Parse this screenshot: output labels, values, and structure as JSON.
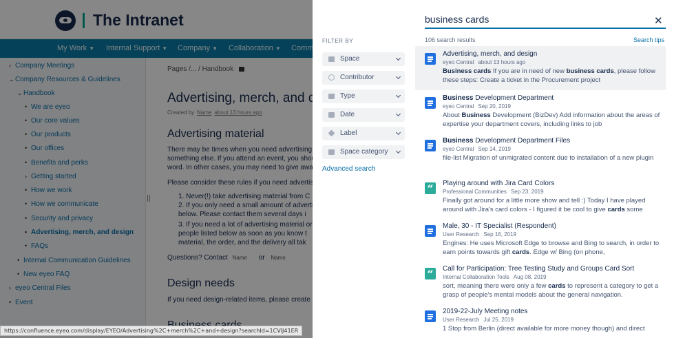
{
  "background": {
    "site_title": "The Intranet",
    "nav": [
      {
        "label": "My Work"
      },
      {
        "label": "Internal Support"
      },
      {
        "label": "Company"
      },
      {
        "label": "Collaboration"
      },
      {
        "label": "Comm"
      }
    ],
    "tree": [
      {
        "marker": "›",
        "label": "Company Meetings"
      },
      {
        "marker": "⌄",
        "label": "Company Resources & Guidelines"
      },
      {
        "marker": "⌄",
        "label": "Handbook"
      },
      {
        "marker": "•",
        "label": "We are eyeo"
      },
      {
        "marker": "•",
        "label": "Our core values"
      },
      {
        "marker": "•",
        "label": "Our products"
      },
      {
        "marker": "•",
        "label": "Our offices"
      },
      {
        "marker": "•",
        "label": "Benefits and perks"
      },
      {
        "marker": "›",
        "label": "Getting started"
      },
      {
        "marker": "•",
        "label": "How we work"
      },
      {
        "marker": "•",
        "label": "How we communicate"
      },
      {
        "marker": "•",
        "label": "Security and privacy"
      },
      {
        "marker": "•",
        "label": "Advertising, merch, and design"
      },
      {
        "marker": "•",
        "label": "FAQs"
      },
      {
        "marker": "•",
        "label": "Internal Communication Guidelines"
      },
      {
        "marker": "•",
        "label": "New eyeo FAQ"
      },
      {
        "marker": "›",
        "label": "eyeo Central Files"
      },
      {
        "marker": "•",
        "label": "Event"
      }
    ],
    "breadcrumb": "Pages /... / Handbook",
    "page_title": "Advertising, merch, and design",
    "created_by_label": "Created by",
    "created_by_name": "Name",
    "created_time": "about 13 hours ago",
    "section1_heading": "Advertising material",
    "body_lines": [
      "There may be times when you need advertising m",
      "something else. If you attend an event, you shou",
      "word. In other cases, you may need to give away"
    ],
    "rules_intro": "Please consider these rules if you need advertisi",
    "rule_lines": [
      "1. Never(!) take advertising material from C",
      "2. If you only need a small amount of adverti",
      "    below. Please contact them several days i",
      "3. If you need a lot of advertising material or",
      "    people listed below as soon as you know t",
      "    material, the order, and the delivery all tak"
    ],
    "questions_label": "Questions? Contact",
    "questions_name1": "Name",
    "questions_or": "or",
    "questions_name2": "Name",
    "section2_heading": "Design needs",
    "section2_text": "If you need design-related items, please create a",
    "section3_heading": "Business cards",
    "status_url": "https://confluence.eyeo.com/display/EYEO/Advertising%2C+merch%2C+and+design?searchId=1CVIJ41ER"
  },
  "search": {
    "query": "business cards",
    "filter_heading": "FILTER BY",
    "filters": [
      {
        "label": "Space",
        "icon": "folder-icon"
      },
      {
        "label": "Contributor",
        "icon": "person-icon"
      },
      {
        "label": "Type",
        "icon": "document-icon"
      },
      {
        "label": "Date",
        "icon": "calendar-icon"
      },
      {
        "label": "Label",
        "icon": "tag-icon"
      },
      {
        "label": "Space category",
        "icon": "folder-stack-icon"
      }
    ],
    "advanced_search": "Advanced search",
    "result_count": "106 search results",
    "search_tips": "Search tips",
    "results": [
      {
        "icon": "page-icon",
        "title": "Advertising, merch, and design",
        "space": "eyeo Central",
        "time": "about 13 hours ago",
        "snippet_html": "<b>Business cards</b> If you are in need of new <b>business cards</b>, please follow these steps: Create a ticket in the Procurement project"
      },
      {
        "icon": "page-icon",
        "title_html": "<b>Business</b> Development Department",
        "space": "eyeo Central",
        "time": "Sep 20, 2019",
        "snippet_html": "About <b>Business</b> Development (BizDev) Add information about the areas of expertise your department covers, including links to job"
      },
      {
        "icon": "page-icon",
        "title_html": "<b>Business</b> Development Department Files",
        "space": "eyeo Central",
        "time": "Sep 14, 2019",
        "snippet_html": "file-list Migration of unmigrated content due to installation of a new plugin"
      },
      {
        "icon": "blog-icon",
        "title": "Playing around with Jira Card Colors",
        "space": "Professional Communities",
        "time": "Sep 23, 2019",
        "snippet_html": "Finally got around for a little more show and tell :) Today I have played around with Jira's card colors - I figured it be cool to give <b>cards</b> some"
      },
      {
        "icon": "page-icon",
        "title": "Male, 30 - IT Specialist (Respondent)",
        "space": "User Research",
        "time": "Sep 16, 2019",
        "snippet_html": "Engines: He uses Microsoft Edge to browse and Bing to search, in order to earn points towards gift <b>cards</b>. Edge w/ Bing (on phone,"
      },
      {
        "icon": "blog-icon",
        "title": "Call for Participation: Tree Testing Study and Groups Card Sort",
        "space": "Internal Collaboration Tools",
        "time": "Aug 08, 2019",
        "snippet_html": "sort, meaning there were only a few <b>cards</b> to represent a category to get a grasp of people's mental models about the general navigation."
      },
      {
        "icon": "page-icon",
        "title": "2019-22-July Meeting notes",
        "space": "User Research",
        "time": "Jul 25, 2019",
        "snippet_html": "1 Stop from Berlin (direct available for more money though) and direct"
      }
    ]
  },
  "colors": {
    "nav_bar": "#0a7ea8",
    "link": "#0a6fa8",
    "page_icon": "#1f6fe0",
    "blog_icon": "#2bab9a",
    "highlight_row": "#f0f1f3"
  }
}
